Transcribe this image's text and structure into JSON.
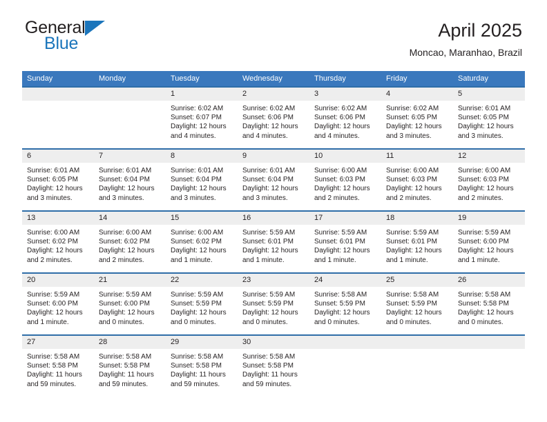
{
  "brand": {
    "name_part1": "General",
    "name_part2": "Blue",
    "color_primary": "#1b75bb",
    "logo_icon": "triangle-flag-icon"
  },
  "header": {
    "title": "April 2025",
    "subtitle": "Moncao, Maranhao, Brazil"
  },
  "colors": {
    "header_row_bg": "#3a78bd",
    "row_divider": "#2e6da8",
    "daynum_band_bg": "#eeeeee",
    "text": "#231f20"
  },
  "weekday_headers": [
    "Sunday",
    "Monday",
    "Tuesday",
    "Wednesday",
    "Thursday",
    "Friday",
    "Saturday"
  ],
  "weeks": [
    [
      {
        "day": "",
        "sunrise": "",
        "sunset": "",
        "daylight_line1": "",
        "daylight_line2": "",
        "empty": true
      },
      {
        "day": "",
        "sunrise": "",
        "sunset": "",
        "daylight_line1": "",
        "daylight_line2": "",
        "empty": true
      },
      {
        "day": "1",
        "sunrise": "Sunrise: 6:02 AM",
        "sunset": "Sunset: 6:07 PM",
        "daylight_line1": "Daylight: 12 hours",
        "daylight_line2": "and 4 minutes.",
        "empty": false
      },
      {
        "day": "2",
        "sunrise": "Sunrise: 6:02 AM",
        "sunset": "Sunset: 6:06 PM",
        "daylight_line1": "Daylight: 12 hours",
        "daylight_line2": "and 4 minutes.",
        "empty": false
      },
      {
        "day": "3",
        "sunrise": "Sunrise: 6:02 AM",
        "sunset": "Sunset: 6:06 PM",
        "daylight_line1": "Daylight: 12 hours",
        "daylight_line2": "and 4 minutes.",
        "empty": false
      },
      {
        "day": "4",
        "sunrise": "Sunrise: 6:02 AM",
        "sunset": "Sunset: 6:05 PM",
        "daylight_line1": "Daylight: 12 hours",
        "daylight_line2": "and 3 minutes.",
        "empty": false
      },
      {
        "day": "5",
        "sunrise": "Sunrise: 6:01 AM",
        "sunset": "Sunset: 6:05 PM",
        "daylight_line1": "Daylight: 12 hours",
        "daylight_line2": "and 3 minutes.",
        "empty": false
      }
    ],
    [
      {
        "day": "6",
        "sunrise": "Sunrise: 6:01 AM",
        "sunset": "Sunset: 6:05 PM",
        "daylight_line1": "Daylight: 12 hours",
        "daylight_line2": "and 3 minutes.",
        "empty": false
      },
      {
        "day": "7",
        "sunrise": "Sunrise: 6:01 AM",
        "sunset": "Sunset: 6:04 PM",
        "daylight_line1": "Daylight: 12 hours",
        "daylight_line2": "and 3 minutes.",
        "empty": false
      },
      {
        "day": "8",
        "sunrise": "Sunrise: 6:01 AM",
        "sunset": "Sunset: 6:04 PM",
        "daylight_line1": "Daylight: 12 hours",
        "daylight_line2": "and 3 minutes.",
        "empty": false
      },
      {
        "day": "9",
        "sunrise": "Sunrise: 6:01 AM",
        "sunset": "Sunset: 6:04 PM",
        "daylight_line1": "Daylight: 12 hours",
        "daylight_line2": "and 3 minutes.",
        "empty": false
      },
      {
        "day": "10",
        "sunrise": "Sunrise: 6:00 AM",
        "sunset": "Sunset: 6:03 PM",
        "daylight_line1": "Daylight: 12 hours",
        "daylight_line2": "and 2 minutes.",
        "empty": false
      },
      {
        "day": "11",
        "sunrise": "Sunrise: 6:00 AM",
        "sunset": "Sunset: 6:03 PM",
        "daylight_line1": "Daylight: 12 hours",
        "daylight_line2": "and 2 minutes.",
        "empty": false
      },
      {
        "day": "12",
        "sunrise": "Sunrise: 6:00 AM",
        "sunset": "Sunset: 6:03 PM",
        "daylight_line1": "Daylight: 12 hours",
        "daylight_line2": "and 2 minutes.",
        "empty": false
      }
    ],
    [
      {
        "day": "13",
        "sunrise": "Sunrise: 6:00 AM",
        "sunset": "Sunset: 6:02 PM",
        "daylight_line1": "Daylight: 12 hours",
        "daylight_line2": "and 2 minutes.",
        "empty": false
      },
      {
        "day": "14",
        "sunrise": "Sunrise: 6:00 AM",
        "sunset": "Sunset: 6:02 PM",
        "daylight_line1": "Daylight: 12 hours",
        "daylight_line2": "and 2 minutes.",
        "empty": false
      },
      {
        "day": "15",
        "sunrise": "Sunrise: 6:00 AM",
        "sunset": "Sunset: 6:02 PM",
        "daylight_line1": "Daylight: 12 hours",
        "daylight_line2": "and 1 minute.",
        "empty": false
      },
      {
        "day": "16",
        "sunrise": "Sunrise: 5:59 AM",
        "sunset": "Sunset: 6:01 PM",
        "daylight_line1": "Daylight: 12 hours",
        "daylight_line2": "and 1 minute.",
        "empty": false
      },
      {
        "day": "17",
        "sunrise": "Sunrise: 5:59 AM",
        "sunset": "Sunset: 6:01 PM",
        "daylight_line1": "Daylight: 12 hours",
        "daylight_line2": "and 1 minute.",
        "empty": false
      },
      {
        "day": "18",
        "sunrise": "Sunrise: 5:59 AM",
        "sunset": "Sunset: 6:01 PM",
        "daylight_line1": "Daylight: 12 hours",
        "daylight_line2": "and 1 minute.",
        "empty": false
      },
      {
        "day": "19",
        "sunrise": "Sunrise: 5:59 AM",
        "sunset": "Sunset: 6:00 PM",
        "daylight_line1": "Daylight: 12 hours",
        "daylight_line2": "and 1 minute.",
        "empty": false
      }
    ],
    [
      {
        "day": "20",
        "sunrise": "Sunrise: 5:59 AM",
        "sunset": "Sunset: 6:00 PM",
        "daylight_line1": "Daylight: 12 hours",
        "daylight_line2": "and 1 minute.",
        "empty": false
      },
      {
        "day": "21",
        "sunrise": "Sunrise: 5:59 AM",
        "sunset": "Sunset: 6:00 PM",
        "daylight_line1": "Daylight: 12 hours",
        "daylight_line2": "and 0 minutes.",
        "empty": false
      },
      {
        "day": "22",
        "sunrise": "Sunrise: 5:59 AM",
        "sunset": "Sunset: 5:59 PM",
        "daylight_line1": "Daylight: 12 hours",
        "daylight_line2": "and 0 minutes.",
        "empty": false
      },
      {
        "day": "23",
        "sunrise": "Sunrise: 5:59 AM",
        "sunset": "Sunset: 5:59 PM",
        "daylight_line1": "Daylight: 12 hours",
        "daylight_line2": "and 0 minutes.",
        "empty": false
      },
      {
        "day": "24",
        "sunrise": "Sunrise: 5:58 AM",
        "sunset": "Sunset: 5:59 PM",
        "daylight_line1": "Daylight: 12 hours",
        "daylight_line2": "and 0 minutes.",
        "empty": false
      },
      {
        "day": "25",
        "sunrise": "Sunrise: 5:58 AM",
        "sunset": "Sunset: 5:59 PM",
        "daylight_line1": "Daylight: 12 hours",
        "daylight_line2": "and 0 minutes.",
        "empty": false
      },
      {
        "day": "26",
        "sunrise": "Sunrise: 5:58 AM",
        "sunset": "Sunset: 5:58 PM",
        "daylight_line1": "Daylight: 12 hours",
        "daylight_line2": "and 0 minutes.",
        "empty": false
      }
    ],
    [
      {
        "day": "27",
        "sunrise": "Sunrise: 5:58 AM",
        "sunset": "Sunset: 5:58 PM",
        "daylight_line1": "Daylight: 11 hours",
        "daylight_line2": "and 59 minutes.",
        "empty": false
      },
      {
        "day": "28",
        "sunrise": "Sunrise: 5:58 AM",
        "sunset": "Sunset: 5:58 PM",
        "daylight_line1": "Daylight: 11 hours",
        "daylight_line2": "and 59 minutes.",
        "empty": false
      },
      {
        "day": "29",
        "sunrise": "Sunrise: 5:58 AM",
        "sunset": "Sunset: 5:58 PM",
        "daylight_line1": "Daylight: 11 hours",
        "daylight_line2": "and 59 minutes.",
        "empty": false
      },
      {
        "day": "30",
        "sunrise": "Sunrise: 5:58 AM",
        "sunset": "Sunset: 5:58 PM",
        "daylight_line1": "Daylight: 11 hours",
        "daylight_line2": "and 59 minutes.",
        "empty": false
      },
      {
        "day": "",
        "sunrise": "",
        "sunset": "",
        "daylight_line1": "",
        "daylight_line2": "",
        "empty": true
      },
      {
        "day": "",
        "sunrise": "",
        "sunset": "",
        "daylight_line1": "",
        "daylight_line2": "",
        "empty": true
      },
      {
        "day": "",
        "sunrise": "",
        "sunset": "",
        "daylight_line1": "",
        "daylight_line2": "",
        "empty": true
      }
    ]
  ]
}
